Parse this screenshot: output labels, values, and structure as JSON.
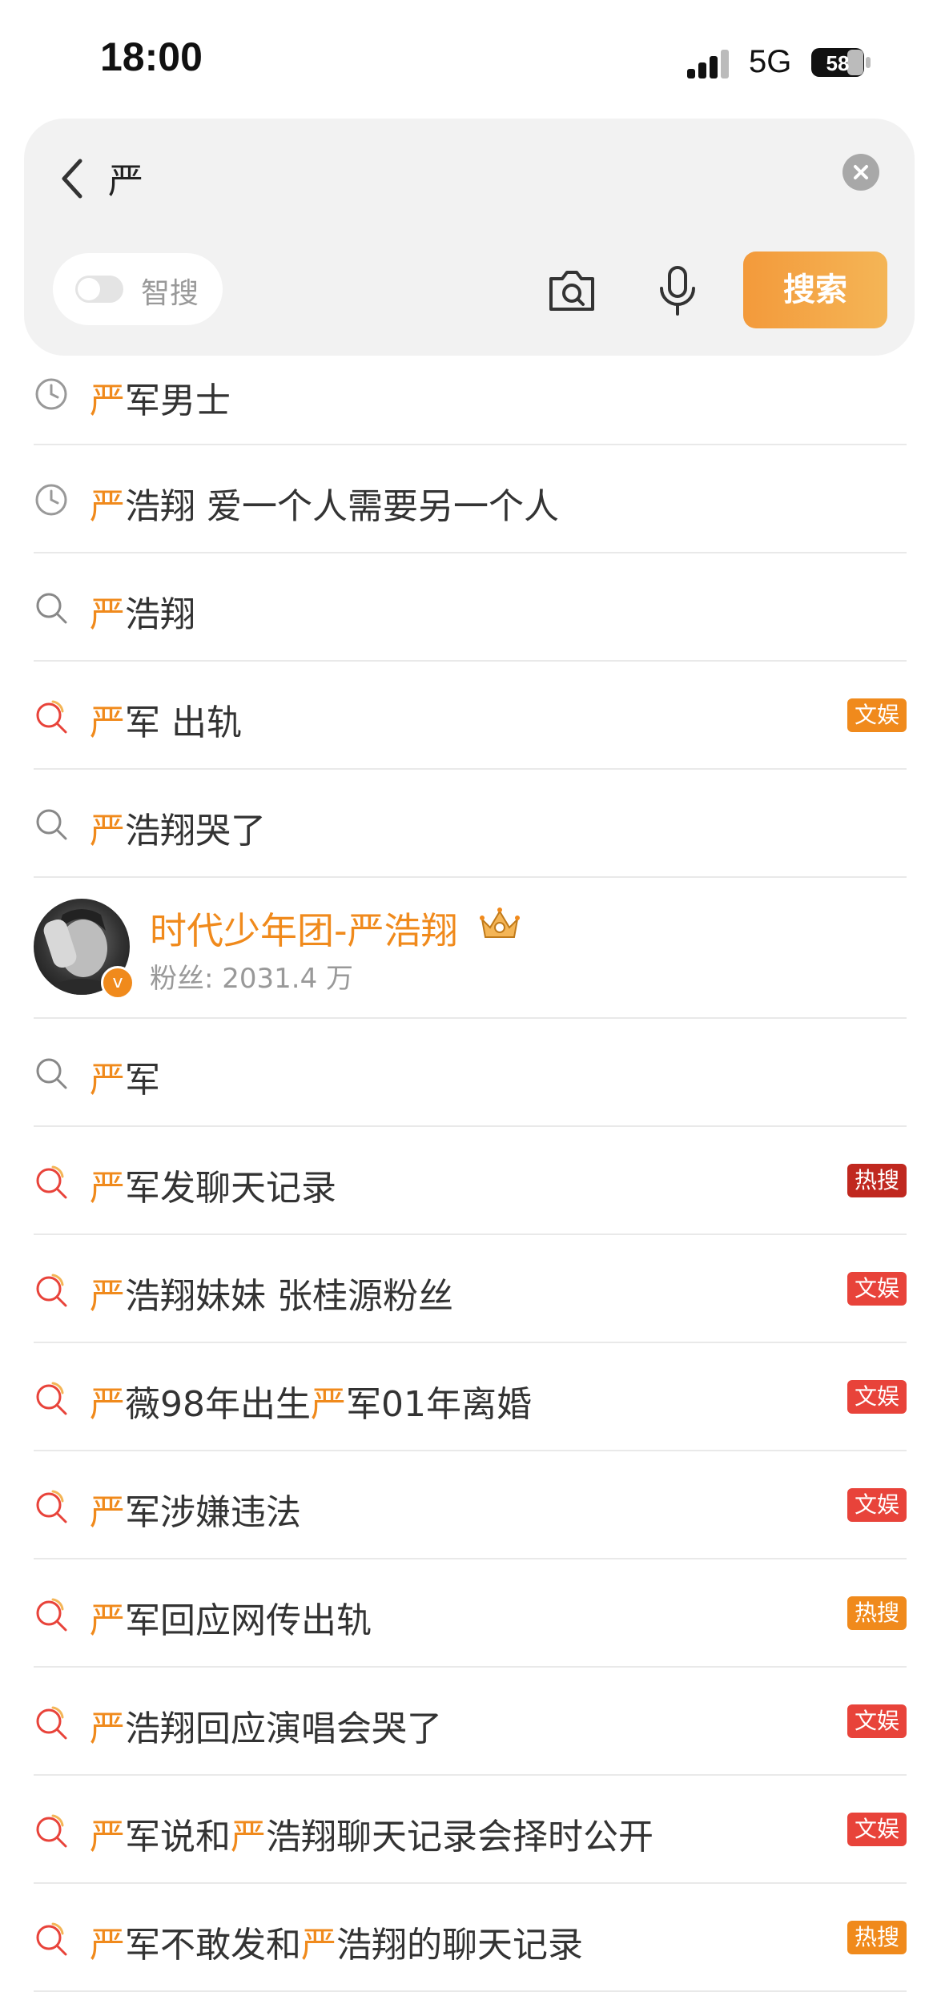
{
  "status_bar": {
    "time": "18:00",
    "network": "5G",
    "battery": "58"
  },
  "search": {
    "query": "严",
    "smart_label": "智搜",
    "search_button": "搜索"
  },
  "suggestions": [
    {
      "type": "history",
      "prefix": "严",
      "rest": "军男士"
    },
    {
      "type": "history",
      "prefix": "严",
      "rest": "浩翔 爱一个人需要另一个人"
    },
    {
      "type": "search",
      "prefix": "严",
      "rest": "浩翔"
    },
    {
      "type": "hot",
      "prefix": "严",
      "rest": "军 出轨",
      "badge": "文娱"
    },
    {
      "type": "search",
      "prefix": "严",
      "rest": "浩翔哭了"
    }
  ],
  "user_card": {
    "name": "时代少年团-严浩翔",
    "fans": "粉丝: 2031.4 万"
  },
  "suggestions2": [
    {
      "type": "search",
      "prefix": "严",
      "rest": "军"
    },
    {
      "type": "hot",
      "prefix": "严",
      "rest": "军发聊天记录",
      "badge": "热搜"
    },
    {
      "type": "hot",
      "prefix": "严",
      "rest": "浩翔妹妹 张桂源粉丝",
      "badge": "文娱"
    },
    {
      "type": "hot",
      "prefix": "严",
      "rest": "薇98年出生",
      "prefix2": "严",
      "rest2": "军01年离婚",
      "badge": "文娱"
    },
    {
      "type": "hot",
      "prefix": "严",
      "rest": "军涉嫌违法",
      "badge": "文娱"
    },
    {
      "type": "hot",
      "prefix": "严",
      "rest": "军回应网传出轨",
      "badge": "热搜"
    },
    {
      "type": "hot",
      "prefix": "严",
      "rest": "浩翔回应演唱会哭了",
      "badge": "文娱"
    },
    {
      "type": "hot",
      "prefix": "严",
      "rest": "军说和",
      "prefix2": "严",
      "rest2": "浩翔聊天记录会择时公开",
      "badge": "文娱"
    },
    {
      "type": "hot",
      "prefix": "严",
      "rest": "军不敢发和",
      "prefix2": "严",
      "rest2": "浩翔的聊天记录",
      "badge": "热搜"
    }
  ],
  "colors": {
    "highlight": "#f08a1c",
    "badge_wenyu": "#e8433a",
    "badge_resou_dark": "#c0281f",
    "badge_resou_orange": "#f08a1c",
    "badge_wenyu_orange": "#f08a1c"
  }
}
